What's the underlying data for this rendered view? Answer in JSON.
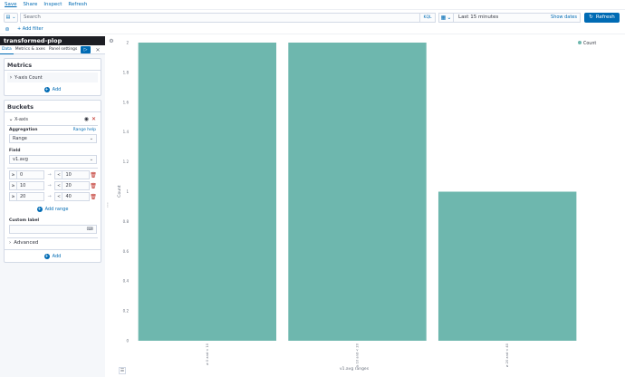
{
  "topnav": {
    "items": [
      "Save",
      "Share",
      "Inspect",
      "Refresh"
    ]
  },
  "querybar": {
    "search_placeholder": "Search",
    "kql_label": "KQL",
    "time_range": "Last 15 minutes",
    "show_dates": "Show dates",
    "refresh_label": "Refresh"
  },
  "filterbar": {
    "add_filter": "+ Add filter"
  },
  "sidebar": {
    "title": "transformed-plop",
    "tabs": [
      "Data",
      "Metrics & axes",
      "Panel settings"
    ],
    "metrics": {
      "title": "Metrics",
      "item_label": "Y-axis Count",
      "add_label": "Add"
    },
    "buckets": {
      "title": "Buckets",
      "item_label": "X-axis",
      "aggregation_label": "Aggregation",
      "range_help": "Range help",
      "aggregation_value": "Range",
      "field_label": "Field",
      "field_value": "v1.avg",
      "ranges": [
        {
          "from_op": "≥",
          "from": "0",
          "to_op": "<",
          "to": "10"
        },
        {
          "from_op": "≥",
          "from": "10",
          "to_op": "<",
          "to": "20"
        },
        {
          "from_op": "≥",
          "from": "20",
          "to_op": "<",
          "to": "40"
        }
      ],
      "add_range": "Add range",
      "custom_label": "Custom label",
      "advanced": "Advanced",
      "add_label": "Add"
    }
  },
  "colors": {
    "accent": "#006bb4",
    "bar": "#6eb7ae",
    "danger": "#bd271e"
  },
  "chart_data": {
    "type": "bar",
    "categories": [
      "≥ 0 and < 10",
      "≥ 10 and < 20",
      "≥ 20 and < 40"
    ],
    "series": [
      {
        "name": "Count",
        "values": [
          2,
          2,
          1
        ]
      }
    ],
    "yticks": [
      "0",
      "0.2",
      "0.4",
      "0.6",
      "0.8",
      "1",
      "1.2",
      "1.4",
      "1.6",
      "1.8",
      "2"
    ],
    "ylim": [
      0,
      2
    ],
    "xlabel": "v1.avg ranges",
    "ylabel": "Count",
    "legend": "top-right"
  }
}
